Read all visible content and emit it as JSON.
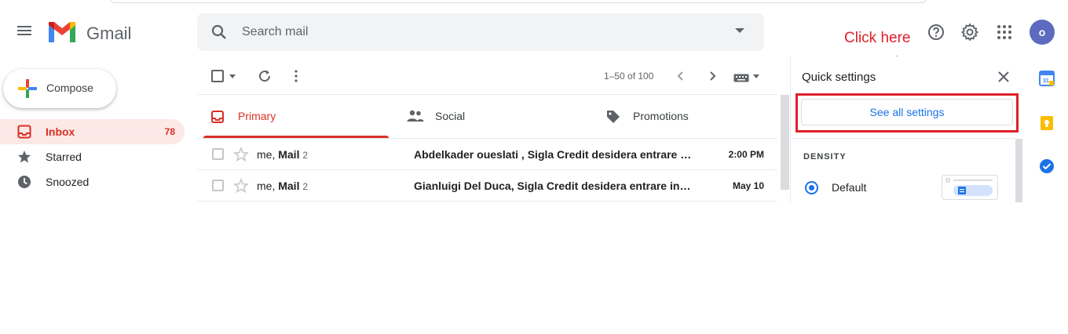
{
  "header": {
    "brand": "Gmail",
    "search_placeholder": "Search mail",
    "avatar_initial": "o"
  },
  "compose": {
    "label": "Compose"
  },
  "sidebar": {
    "items": [
      {
        "label": "Inbox",
        "count": "78",
        "active": true
      },
      {
        "label": "Starred"
      },
      {
        "label": "Snoozed"
      }
    ]
  },
  "toolbar": {
    "pagination": "1–50 of 100"
  },
  "tabs": [
    {
      "label": "Primary",
      "active": true
    },
    {
      "label": "Social"
    },
    {
      "label": "Promotions"
    }
  ],
  "emails": [
    {
      "sender_prefix": "me, ",
      "sender_name": "Mail",
      "count": "2",
      "subject": "Abdelkader oueslati , Sigla Credit desidera entrare in contatto con te",
      "date": "2:00 PM"
    },
    {
      "sender_prefix": "me, ",
      "sender_name": "Mail",
      "count": "2",
      "subject": "Gianluigi Del Duca, Sigla Credit desidera entrare in contatto con te",
      "date": "May 10"
    }
  ],
  "quick_settings": {
    "title": "Quick settings",
    "see_all": "See all settings",
    "density_heading": "DENSITY",
    "density_option": "Default"
  },
  "annotation": {
    "text": "Click here",
    "color": "#e0202a"
  },
  "colors": {
    "accent_red": "#d93025",
    "link_blue": "#1a73e8",
    "avatar": "#5c6bc0"
  }
}
